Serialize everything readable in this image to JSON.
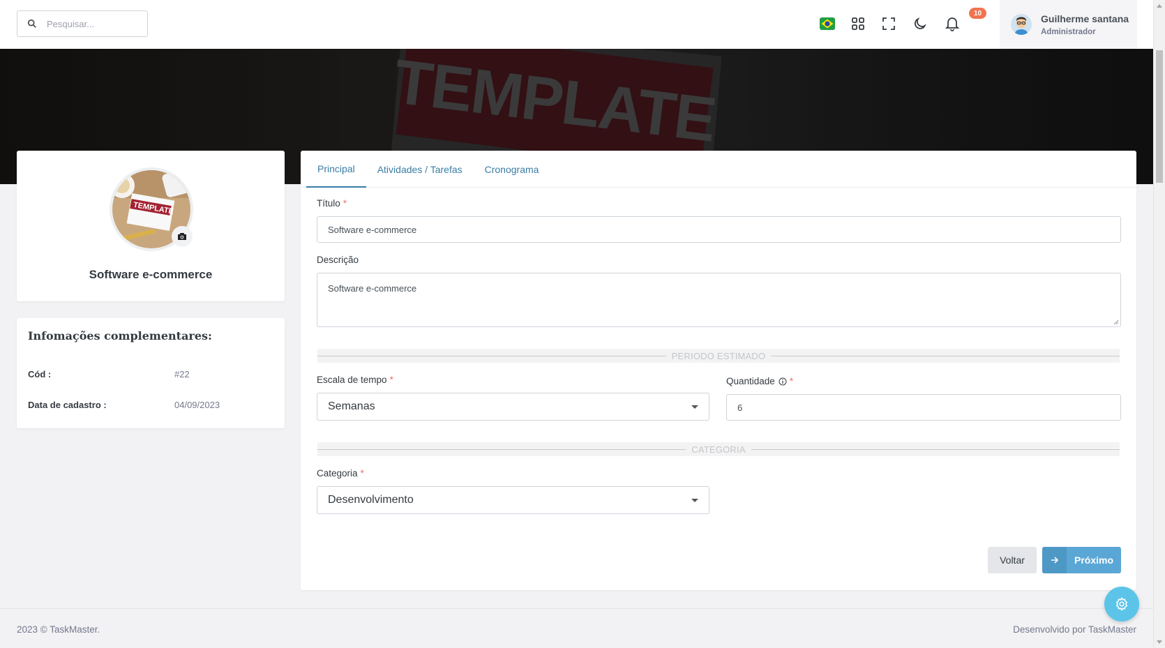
{
  "search": {
    "placeholder": "Pesquisar..."
  },
  "header": {
    "notification_count": "10",
    "user_name": "Guilherme santana",
    "user_role": "Administrador"
  },
  "cover": {
    "image_text": "TEMPLATE"
  },
  "profile": {
    "picture_text": "TEMPLATE",
    "project_name": "Software e-commerce"
  },
  "info": {
    "title": "Infomações complementares:",
    "rows": [
      {
        "label": "Cód :",
        "value": "#22"
      },
      {
        "label": "Data de cadastro :",
        "value": "04/09/2023"
      }
    ]
  },
  "tabs": [
    {
      "label": "Principal",
      "active": true
    },
    {
      "label": "Atividades / Tarefas",
      "active": false
    },
    {
      "label": "Cronograma",
      "active": false
    }
  ],
  "form": {
    "title_label": "Título",
    "title_value": "Software e-commerce",
    "description_label": "Descrição",
    "description_value": "Software e-commerce",
    "period_section": "PERIODO ESTIMADO",
    "scale_label": "Escala de tempo",
    "scale_value": "Semanas",
    "quantity_label": "Quantidade",
    "quantity_value": "6",
    "category_section": "CATEGORIA",
    "category_label": "Categoria",
    "category_value": "Desenvolvimento",
    "required_mark": "*"
  },
  "actions": {
    "back_label": "Voltar",
    "next_label": "Próximo"
  },
  "footer": {
    "left": "2023 © TaskMaster.",
    "right": "Desenvolvido por TaskMaster"
  },
  "colors": {
    "primary": "#3a7ca5",
    "button_next": "#5aa7d6",
    "badge": "#f1734f",
    "fab": "#5cc4e8",
    "required": "#f46a6a"
  }
}
